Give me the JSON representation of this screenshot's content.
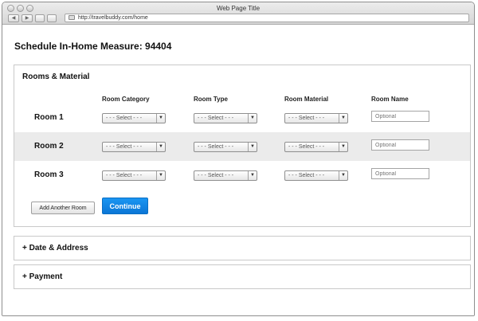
{
  "window": {
    "title": "Web Page Title",
    "url": "http://travelbuddy.com/home"
  },
  "page": {
    "title": "Schedule In-Home Measure: 94404"
  },
  "rooms_panel": {
    "heading": "Rooms & Material",
    "columns": [
      "Room Category",
      "Room Type",
      "Room Material",
      "Room Name"
    ],
    "select_placeholder": "- - - Select - - -",
    "name_placeholder": "Optional",
    "rows": [
      {
        "label": "Room 1"
      },
      {
        "label": "Room 2"
      },
      {
        "label": "Room 3"
      }
    ],
    "add_button": "Add Another Room",
    "continue_button": "Continue"
  },
  "date_panel": {
    "heading": "+ Date & Address"
  },
  "payment_panel": {
    "heading": "+ Payment"
  },
  "icons": {
    "dropdown": "chevron-down-icon",
    "url": "page-icon"
  },
  "colors": {
    "primary_button": "#1a8ae8",
    "row_shade": "#ebebeb"
  }
}
